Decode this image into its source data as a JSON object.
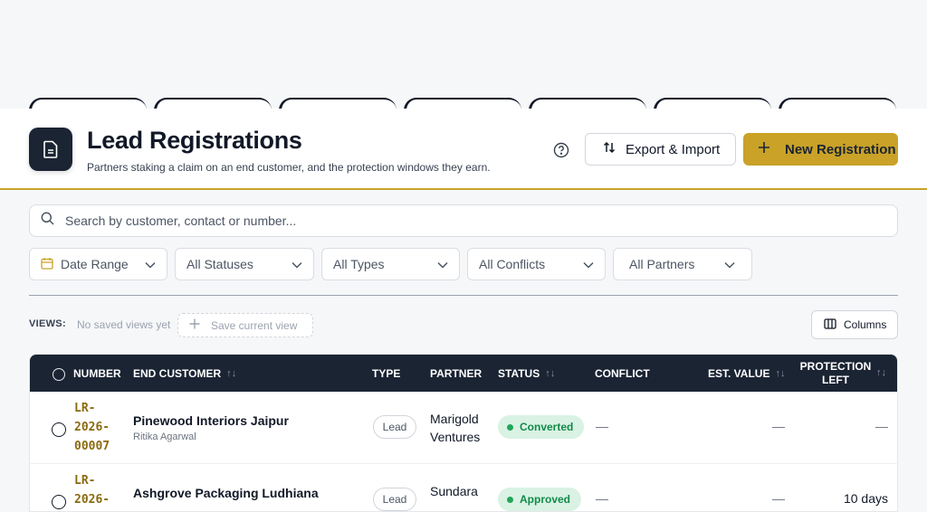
{
  "header": {
    "title": "Lead Registrations",
    "subtitle": "Partners staking a claim on an end customer, and the protection windows they earn.",
    "export_label": "Export & Import",
    "new_label": "New Registration"
  },
  "search": {
    "placeholder": "Search by customer, contact or number..."
  },
  "filters": [
    {
      "label": "Date Range"
    },
    {
      "label": "All Statuses"
    },
    {
      "label": "All Types"
    },
    {
      "label": "All Conflicts"
    },
    {
      "label": "All Partners"
    }
  ],
  "views": {
    "label": "VIEWS:",
    "empty": "No saved views yet",
    "save_label": "Save current view",
    "columns_label": "Columns"
  },
  "table": {
    "columns": {
      "number": "NUMBER",
      "customer": "END CUSTOMER",
      "type": "TYPE",
      "partner": "PARTNER",
      "status": "STATUS",
      "conflict": "CONFLICT",
      "value": "EST. VALUE",
      "protection": "PROTECTION LEFT",
      "sort_glyph": "↑↓"
    },
    "rows": [
      {
        "number": "LR-2026-00007",
        "number_lines": [
          "LR-",
          "2026-",
          "00007"
        ],
        "customer": "Pinewood Interiors Jaipur",
        "contact": "Ritika Agarwal",
        "type": "Lead",
        "partner_lines": [
          "Marigold",
          "Ventures"
        ],
        "status": "Converted",
        "conflict": "—",
        "value": "—",
        "protection": "—"
      },
      {
        "number": "LR-2026-",
        "number_lines": [
          "LR-",
          "2026-"
        ],
        "customer": "Ashgrove Packaging Ludhiana",
        "contact": "",
        "type": "Lead",
        "partner_lines": [
          "Sundara",
          ""
        ],
        "status": "Approved",
        "conflict": "—",
        "value": "—",
        "protection": "10 days"
      }
    ]
  },
  "colors": {
    "accent": "#c9a227",
    "navy": "#1b2433",
    "status_green": "#138a4a"
  }
}
